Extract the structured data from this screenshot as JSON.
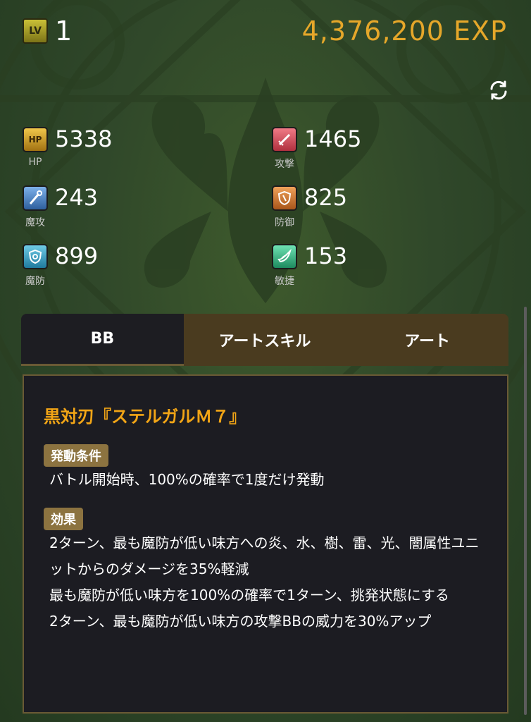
{
  "level": {
    "badge": "LV",
    "value": "1"
  },
  "exp": "4,376,200 EXP",
  "stats": [
    {
      "key": "hp",
      "label": "HP",
      "value": "5338",
      "icon": "hp-icon",
      "icon_text": "HP",
      "color": "#c99a1a"
    },
    {
      "key": "atk",
      "label": "攻撃",
      "value": "1465",
      "icon": "sword-icon",
      "icon_text": "",
      "color": "#c93c48"
    },
    {
      "key": "matk",
      "label": "魔攻",
      "value": "243",
      "icon": "wand-icon",
      "icon_text": "",
      "color": "#3f74b8"
    },
    {
      "key": "def",
      "label": "防御",
      "value": "825",
      "icon": "shield-icon",
      "icon_text": "",
      "color": "#c66a1e"
    },
    {
      "key": "mdef",
      "label": "魔防",
      "value": "899",
      "icon": "magic-shield-icon",
      "icon_text": "",
      "color": "#2d8cb0"
    },
    {
      "key": "agi",
      "label": "敏捷",
      "value": "153",
      "icon": "wing-icon",
      "icon_text": "",
      "color": "#2aa87a"
    }
  ],
  "tabs": [
    {
      "label": "BB",
      "active": true
    },
    {
      "label": "アートスキル",
      "active": false
    },
    {
      "label": "アート",
      "active": false
    }
  ],
  "skill": {
    "name": "黒対刃『ステルガルＭ７』",
    "condition_label": "発動条件",
    "condition_text": "バトル開始時、100%の確率で1度だけ発動",
    "effect_label": "効果",
    "effect_lines": [
      "2ターン、最も魔防が低い味方への炎、水、樹、雷、光、闇属性ユニットからのダメージを35%軽減",
      "最も魔防が低い味方を100%の確率で1ターン、挑発状態にする",
      "2ターン、最も魔防が低い味方の攻撃BBの威力を30%アップ"
    ]
  },
  "colors": {
    "accent": "#e5a72a",
    "skill_name": "#f2a516",
    "tag_bg": "#8c7340"
  }
}
